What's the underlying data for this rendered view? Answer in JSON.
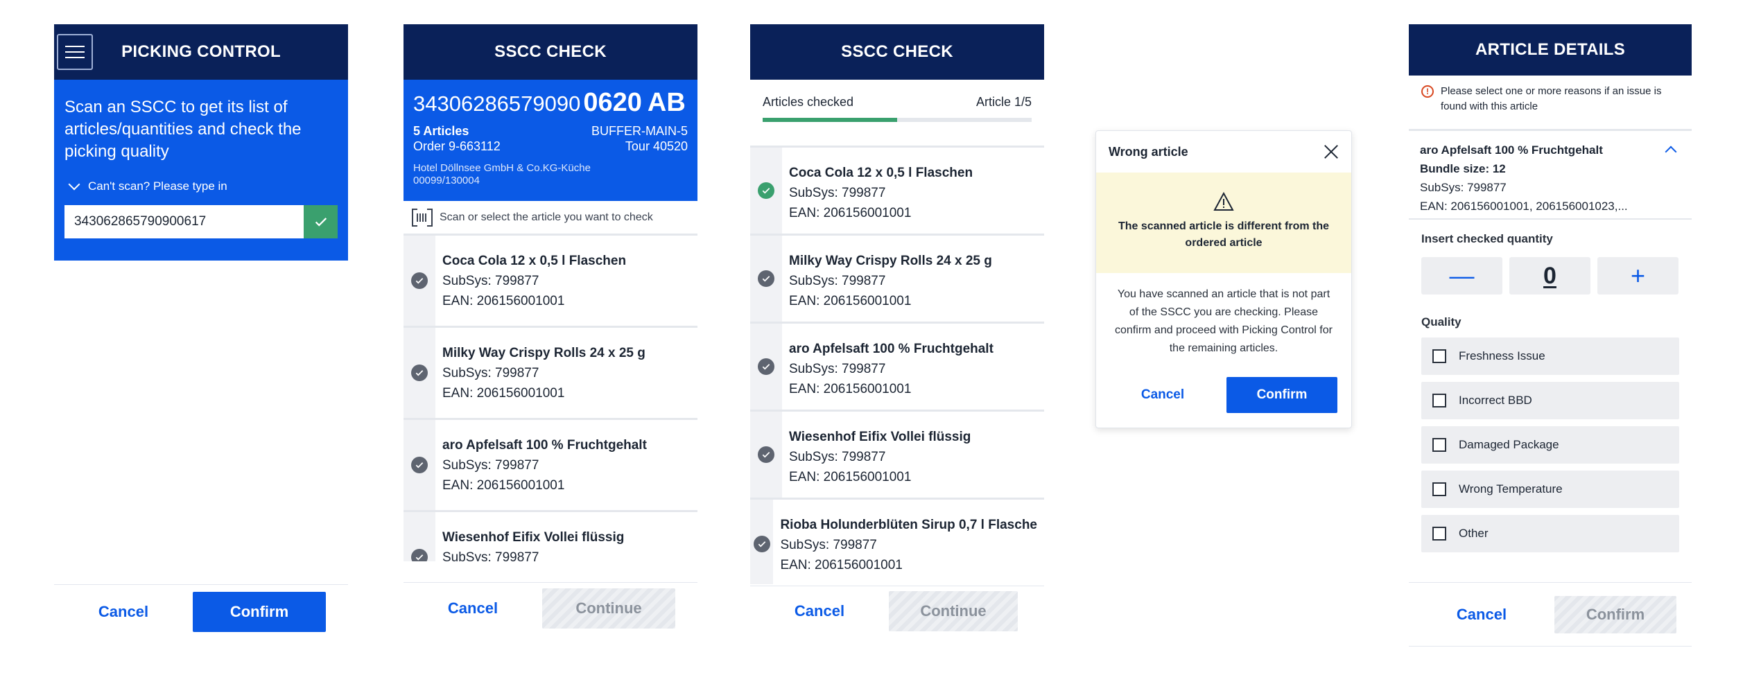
{
  "screen1": {
    "title": "PICKING CONTROL",
    "intro": "Scan an SSCC to get its list of articles/quantities and check the picking quality",
    "toggle_label": "Can't scan? Please type in",
    "sscc_value": "343062865790900617",
    "cancel": "Cancel",
    "confirm": "Confirm"
  },
  "screen2": {
    "title": "SSCC CHECK",
    "sscc_prefix": "34306286579090",
    "sscc_mid": "0620",
    "sscc_suffix": "AB",
    "articles_count": "5 Articles",
    "buffer": "BUFFER-MAIN-5",
    "order": "Order 9-663112",
    "tour": "Tour 40520",
    "customer_line1": "Hotel Döllnsee GmbH & Co.KG-Küche",
    "customer_line2": "00099/130004",
    "scan_hint": "Scan or select the article you want to check",
    "items": [
      {
        "title": "Coca Cola  12 x 0,5 l Flaschen",
        "subsys": "SubSys: 799877",
        "ean": "EAN: 206156001001"
      },
      {
        "title": "Milky Way Crispy Rolls  24 x 25 g",
        "subsys": "SubSys: 799877",
        "ean": "EAN: 206156001001"
      },
      {
        "title": "aro Apfelsaft 100 % Fruchtgehalt",
        "subsys": "SubSys: 799877",
        "ean": "EAN: 206156001001"
      },
      {
        "title": "Wiesenhof Eifix Vollei flüssig",
        "subsys": "SubSys: 799877",
        "ean": ""
      }
    ],
    "cancel": "Cancel",
    "continue": "Continue"
  },
  "screen3": {
    "title": "SSCC CHECK",
    "progress_label": "Articles checked",
    "progress_count": "Article 1/5",
    "progress_fraction": 0.5,
    "items": [
      {
        "title": "Coca Cola  12 x 0,5 l Flaschen",
        "subsys": "SubSys: 799877",
        "ean": "EAN: 206156001001",
        "status": "checked"
      },
      {
        "title": "Milky Way Crispy Rolls  24 x 25 g",
        "subsys": "SubSys: 799877",
        "ean": "EAN: 206156001001",
        "status": "pending"
      },
      {
        "title": "aro Apfelsaft 100 % Fruchtgehalt",
        "subsys": "SubSys: 799877",
        "ean": "EAN: 206156001001",
        "status": "pending"
      },
      {
        "title": "Wiesenhof Eifix Vollei flüssig",
        "subsys": "SubSys: 799877",
        "ean": "EAN: 206156001001",
        "status": "pending"
      },
      {
        "title": "Rioba Holunderblüten Sirup 0,7 l Flasche",
        "subsys": "SubSys: 799877",
        "ean": "EAN: 206156001001",
        "status": "pending"
      }
    ],
    "cancel": "Cancel",
    "continue": "Continue"
  },
  "dialog": {
    "title": "Wrong article",
    "warning": "The scanned article is different from the ordered article",
    "body": "You have scanned an article that is not part of the SSCC you are checking. Please confirm and proceed with Picking Control for the remaining articles.",
    "cancel": "Cancel",
    "confirm": "Confirm"
  },
  "screen5": {
    "title": "ARTICLE DETAILS",
    "note": "Please select one or more reasons if an issue is found with this article",
    "article_title": "aro Apfelsaft 100 % Fruchtgehalt",
    "bundle": "Bundle size: 12",
    "subsys": "SubSys: 799877",
    "ean": "EAN: 206156001001, 206156001023,...",
    "qty_label": "Insert checked quantity",
    "qty_value": "0",
    "quality_label": "Quality",
    "options": [
      "Freshness Issue",
      "Incorrect BBD",
      "Damaged Package",
      "Wrong Temperature",
      "Other"
    ],
    "cancel": "Cancel",
    "confirm": "Confirm"
  },
  "colors": {
    "header": "#0a2159",
    "primary": "#0b5ae6",
    "success": "#3aa06e",
    "warning_bg": "#fbf7da"
  }
}
